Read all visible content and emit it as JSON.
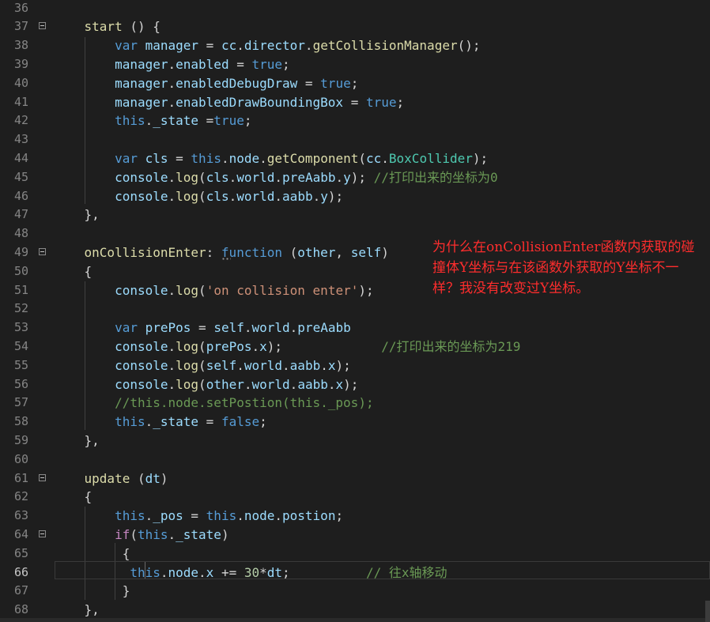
{
  "editor": {
    "annotation": "为什么在onCollisionEnter函数内获取的碰撞体Y坐标与在该函数外获取的Y坐标不一样？我没有改变过Y坐标。",
    "lines": [
      {
        "n": "36",
        "fold": false,
        "tokens": []
      },
      {
        "n": "37",
        "fold": true,
        "tokens": [
          [
            "    ",
            "p"
          ],
          [
            "start",
            "f"
          ],
          [
            " () {",
            "p"
          ]
        ]
      },
      {
        "n": "38",
        "fold": false,
        "tokens": [
          [
            "        ",
            "p"
          ],
          [
            "var",
            "k"
          ],
          [
            " ",
            "p"
          ],
          [
            "manager",
            "v"
          ],
          [
            " = ",
            "o"
          ],
          [
            "cc",
            "v"
          ],
          [
            ".",
            "p"
          ],
          [
            "director",
            "v"
          ],
          [
            ".",
            "p"
          ],
          [
            "getCollisionManager",
            "f"
          ],
          [
            "();",
            "p"
          ]
        ]
      },
      {
        "n": "39",
        "fold": false,
        "tokens": [
          [
            "        ",
            "p"
          ],
          [
            "manager",
            "v"
          ],
          [
            ".",
            "p"
          ],
          [
            "enabled",
            "v"
          ],
          [
            " = ",
            "o"
          ],
          [
            "true",
            "k"
          ],
          [
            ";",
            "p"
          ]
        ]
      },
      {
        "n": "40",
        "fold": false,
        "tokens": [
          [
            "        ",
            "p"
          ],
          [
            "manager",
            "v"
          ],
          [
            ".",
            "p"
          ],
          [
            "enabledDebugDraw",
            "v"
          ],
          [
            " = ",
            "o"
          ],
          [
            "true",
            "k"
          ],
          [
            ";",
            "p"
          ]
        ]
      },
      {
        "n": "41",
        "fold": false,
        "tokens": [
          [
            "        ",
            "p"
          ],
          [
            "manager",
            "v"
          ],
          [
            ".",
            "p"
          ],
          [
            "enabledDrawBoundingBox",
            "v"
          ],
          [
            " = ",
            "o"
          ],
          [
            "true",
            "k"
          ],
          [
            ";",
            "p"
          ]
        ]
      },
      {
        "n": "42",
        "fold": false,
        "tokens": [
          [
            "        ",
            "p"
          ],
          [
            "this",
            "k"
          ],
          [
            ".",
            "p"
          ],
          [
            "_state",
            "v"
          ],
          [
            " =",
            "o"
          ],
          [
            "true",
            "k"
          ],
          [
            ";",
            "p"
          ]
        ]
      },
      {
        "n": "43",
        "fold": false,
        "tokens": []
      },
      {
        "n": "44",
        "fold": false,
        "tokens": [
          [
            "        ",
            "p"
          ],
          [
            "var",
            "k"
          ],
          [
            " ",
            "p"
          ],
          [
            "cls",
            "v"
          ],
          [
            " = ",
            "o"
          ],
          [
            "this",
            "k"
          ],
          [
            ".",
            "p"
          ],
          [
            "node",
            "v"
          ],
          [
            ".",
            "p"
          ],
          [
            "getComponent",
            "f"
          ],
          [
            "(",
            "p"
          ],
          [
            "cc",
            "v"
          ],
          [
            ".",
            "p"
          ],
          [
            "BoxCollider",
            "cl"
          ],
          [
            ");",
            "p"
          ]
        ]
      },
      {
        "n": "45",
        "fold": false,
        "tokens": [
          [
            "        ",
            "p"
          ],
          [
            "console",
            "v"
          ],
          [
            ".",
            "p"
          ],
          [
            "log",
            "f"
          ],
          [
            "(",
            "p"
          ],
          [
            "cls",
            "v"
          ],
          [
            ".",
            "p"
          ],
          [
            "world",
            "v"
          ],
          [
            ".",
            "p"
          ],
          [
            "preAabb",
            "v"
          ],
          [
            ".",
            "p"
          ],
          [
            "y",
            "v"
          ],
          [
            "); ",
            "p"
          ],
          [
            "//打印出来的坐标为0",
            "c"
          ]
        ]
      },
      {
        "n": "46",
        "fold": false,
        "tokens": [
          [
            "        ",
            "p"
          ],
          [
            "console",
            "v"
          ],
          [
            ".",
            "p"
          ],
          [
            "log",
            "f"
          ],
          [
            "(",
            "p"
          ],
          [
            "cls",
            "v"
          ],
          [
            ".",
            "p"
          ],
          [
            "world",
            "v"
          ],
          [
            ".",
            "p"
          ],
          [
            "aabb",
            "v"
          ],
          [
            ".",
            "p"
          ],
          [
            "y",
            "v"
          ],
          [
            ");",
            "p"
          ]
        ]
      },
      {
        "n": "47",
        "fold": false,
        "tokens": [
          [
            "    },",
            "p"
          ]
        ]
      },
      {
        "n": "48",
        "fold": false,
        "tokens": []
      },
      {
        "n": "49",
        "fold": true,
        "tokens": [
          [
            "    ",
            "p"
          ],
          [
            "onCollisionEnter",
            "f"
          ],
          [
            ": ",
            "p"
          ],
          [
            "function",
            "k"
          ],
          [
            " (",
            "p"
          ],
          [
            "other",
            "v"
          ],
          [
            ", ",
            "p"
          ],
          [
            "self",
            "v"
          ],
          [
            ")",
            "p"
          ]
        ]
      },
      {
        "n": "50",
        "fold": false,
        "tokens": [
          [
            "    {",
            "p"
          ]
        ]
      },
      {
        "n": "51",
        "fold": false,
        "tokens": [
          [
            "        ",
            "p"
          ],
          [
            "console",
            "v"
          ],
          [
            ".",
            "p"
          ],
          [
            "log",
            "f"
          ],
          [
            "(",
            "p"
          ],
          [
            "'on collision enter'",
            "s"
          ],
          [
            ");",
            "p"
          ]
        ]
      },
      {
        "n": "52",
        "fold": false,
        "tokens": []
      },
      {
        "n": "53",
        "fold": false,
        "tokens": [
          [
            "        ",
            "p"
          ],
          [
            "var",
            "k"
          ],
          [
            " ",
            "p"
          ],
          [
            "prePos",
            "v"
          ],
          [
            " = ",
            "o"
          ],
          [
            "self",
            "v"
          ],
          [
            ".",
            "p"
          ],
          [
            "world",
            "v"
          ],
          [
            ".",
            "p"
          ],
          [
            "preAabb",
            "v"
          ]
        ]
      },
      {
        "n": "54",
        "fold": false,
        "tokens": [
          [
            "        ",
            "p"
          ],
          [
            "console",
            "v"
          ],
          [
            ".",
            "p"
          ],
          [
            "log",
            "f"
          ],
          [
            "(",
            "p"
          ],
          [
            "prePos",
            "v"
          ],
          [
            ".",
            "p"
          ],
          [
            "x",
            "v"
          ],
          [
            ");             ",
            "p"
          ],
          [
            "//打印出来的坐标为219",
            "c"
          ]
        ]
      },
      {
        "n": "55",
        "fold": false,
        "tokens": [
          [
            "        ",
            "p"
          ],
          [
            "console",
            "v"
          ],
          [
            ".",
            "p"
          ],
          [
            "log",
            "f"
          ],
          [
            "(",
            "p"
          ],
          [
            "self",
            "v"
          ],
          [
            ".",
            "p"
          ],
          [
            "world",
            "v"
          ],
          [
            ".",
            "p"
          ],
          [
            "aabb",
            "v"
          ],
          [
            ".",
            "p"
          ],
          [
            "x",
            "v"
          ],
          [
            ");",
            "p"
          ]
        ]
      },
      {
        "n": "56",
        "fold": false,
        "tokens": [
          [
            "        ",
            "p"
          ],
          [
            "console",
            "v"
          ],
          [
            ".",
            "p"
          ],
          [
            "log",
            "f"
          ],
          [
            "(",
            "p"
          ],
          [
            "other",
            "v"
          ],
          [
            ".",
            "p"
          ],
          [
            "world",
            "v"
          ],
          [
            ".",
            "p"
          ],
          [
            "aabb",
            "v"
          ],
          [
            ".",
            "p"
          ],
          [
            "x",
            "v"
          ],
          [
            ");",
            "p"
          ]
        ]
      },
      {
        "n": "57",
        "fold": false,
        "tokens": [
          [
            "        ",
            "p"
          ],
          [
            "//this.node.setPostion(this._pos);",
            "c"
          ]
        ]
      },
      {
        "n": "58",
        "fold": false,
        "tokens": [
          [
            "        ",
            "p"
          ],
          [
            "this",
            "k"
          ],
          [
            ".",
            "p"
          ],
          [
            "_state",
            "v"
          ],
          [
            " = ",
            "o"
          ],
          [
            "false",
            "k"
          ],
          [
            ";",
            "p"
          ]
        ]
      },
      {
        "n": "59",
        "fold": false,
        "tokens": [
          [
            "    },",
            "p"
          ]
        ]
      },
      {
        "n": "60",
        "fold": false,
        "tokens": []
      },
      {
        "n": "61",
        "fold": true,
        "tokens": [
          [
            "    ",
            "p"
          ],
          [
            "update",
            "f"
          ],
          [
            " (",
            "p"
          ],
          [
            "dt",
            "v"
          ],
          [
            ")",
            "p"
          ]
        ]
      },
      {
        "n": "62",
        "fold": false,
        "tokens": [
          [
            "    {",
            "p"
          ]
        ]
      },
      {
        "n": "63",
        "fold": false,
        "tokens": [
          [
            "        ",
            "p"
          ],
          [
            "this",
            "k"
          ],
          [
            ".",
            "p"
          ],
          [
            "_pos",
            "v"
          ],
          [
            " = ",
            "o"
          ],
          [
            "this",
            "k"
          ],
          [
            ".",
            "p"
          ],
          [
            "node",
            "v"
          ],
          [
            ".",
            "p"
          ],
          [
            "postion",
            "v"
          ],
          [
            ";",
            "p"
          ]
        ]
      },
      {
        "n": "64",
        "fold": true,
        "tokens": [
          [
            "        ",
            "p"
          ],
          [
            "if",
            "ctl"
          ],
          [
            "(",
            "p"
          ],
          [
            "this",
            "k"
          ],
          [
            ".",
            "p"
          ],
          [
            "_state",
            "v"
          ],
          [
            ")",
            "p"
          ]
        ]
      },
      {
        "n": "65",
        "fold": false,
        "tokens": [
          [
            "         {",
            "p"
          ]
        ]
      },
      {
        "n": "66",
        "fold": false,
        "current": true,
        "tokens": [
          [
            "          ",
            "p"
          ],
          [
            "this",
            "k"
          ],
          [
            ".",
            "p"
          ],
          [
            "node",
            "v"
          ],
          [
            ".",
            "p"
          ],
          [
            "x",
            "v"
          ],
          [
            " += ",
            "o"
          ],
          [
            "30",
            "n"
          ],
          [
            "*",
            "o"
          ],
          [
            "dt",
            "v"
          ],
          [
            ";          ",
            "p"
          ],
          [
            "// 往x轴移动",
            "c"
          ]
        ]
      },
      {
        "n": "67",
        "fold": false,
        "tokens": [
          [
            "         }",
            "p"
          ]
        ]
      },
      {
        "n": "68",
        "fold": false,
        "tokens": [
          [
            "    },",
            "p"
          ]
        ]
      }
    ]
  }
}
